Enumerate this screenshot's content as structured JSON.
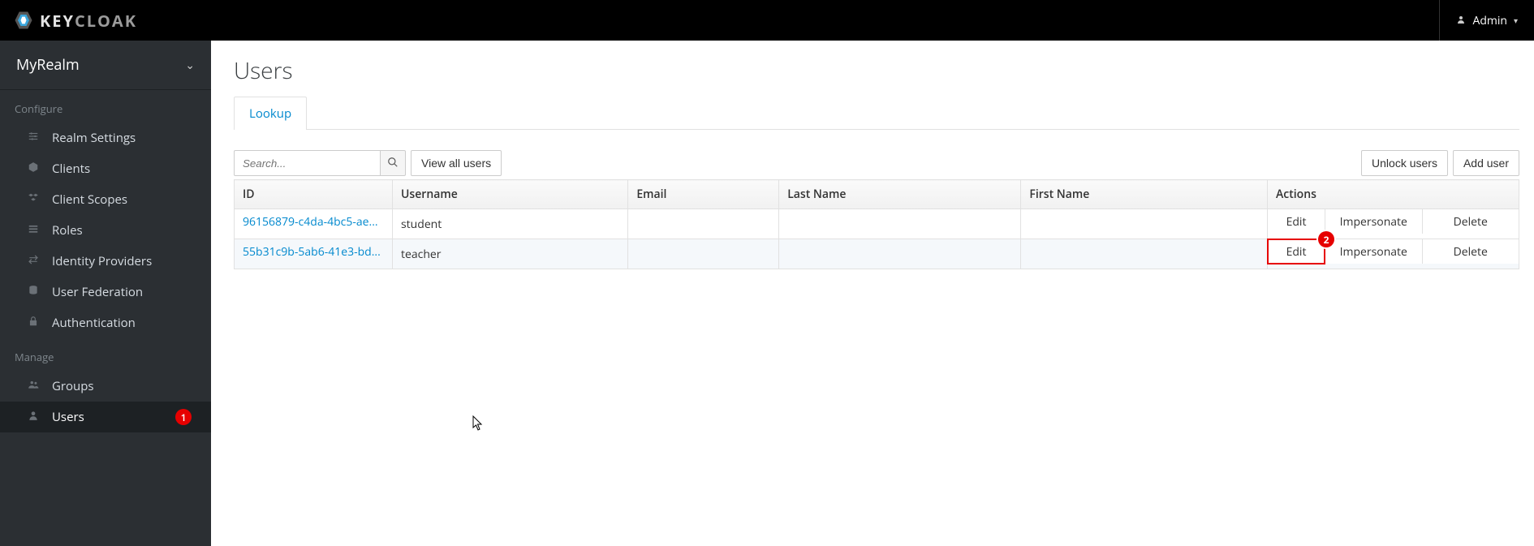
{
  "header": {
    "brand_prefix": "KEY",
    "brand_suffix": "CLOAK",
    "user_label": "Admin"
  },
  "sidebar": {
    "realm": "MyRealm",
    "sections": [
      {
        "label": "Configure",
        "items": [
          {
            "label": "Realm Settings",
            "icon": "sliders"
          },
          {
            "label": "Clients",
            "icon": "cube"
          },
          {
            "label": "Client Scopes",
            "icon": "cubes"
          },
          {
            "label": "Roles",
            "icon": "list"
          },
          {
            "label": "Identity Providers",
            "icon": "exchange"
          },
          {
            "label": "User Federation",
            "icon": "database"
          },
          {
            "label": "Authentication",
            "icon": "lock"
          }
        ]
      },
      {
        "label": "Manage",
        "items": [
          {
            "label": "Groups",
            "icon": "users"
          },
          {
            "label": "Users",
            "icon": "user",
            "active": true,
            "badge": "1"
          }
        ]
      }
    ]
  },
  "page": {
    "title": "Users",
    "tab": "Lookup",
    "search_placeholder": "Search...",
    "view_all": "View all users",
    "unlock": "Unlock users",
    "add": "Add user"
  },
  "table": {
    "columns": [
      "ID",
      "Username",
      "Email",
      "Last Name",
      "First Name",
      "Actions"
    ],
    "action_labels": {
      "edit": "Edit",
      "impersonate": "Impersonate",
      "delete": "Delete"
    },
    "rows": [
      {
        "id": "96156879-c4da-4bc5-ae...",
        "username": "student",
        "email": "",
        "last": "",
        "first": ""
      },
      {
        "id": "55b31c9b-5ab6-41e3-bd...",
        "username": "teacher",
        "email": "",
        "last": "",
        "first": ""
      }
    ]
  },
  "callout": {
    "row_index": 1,
    "badge": "2"
  }
}
